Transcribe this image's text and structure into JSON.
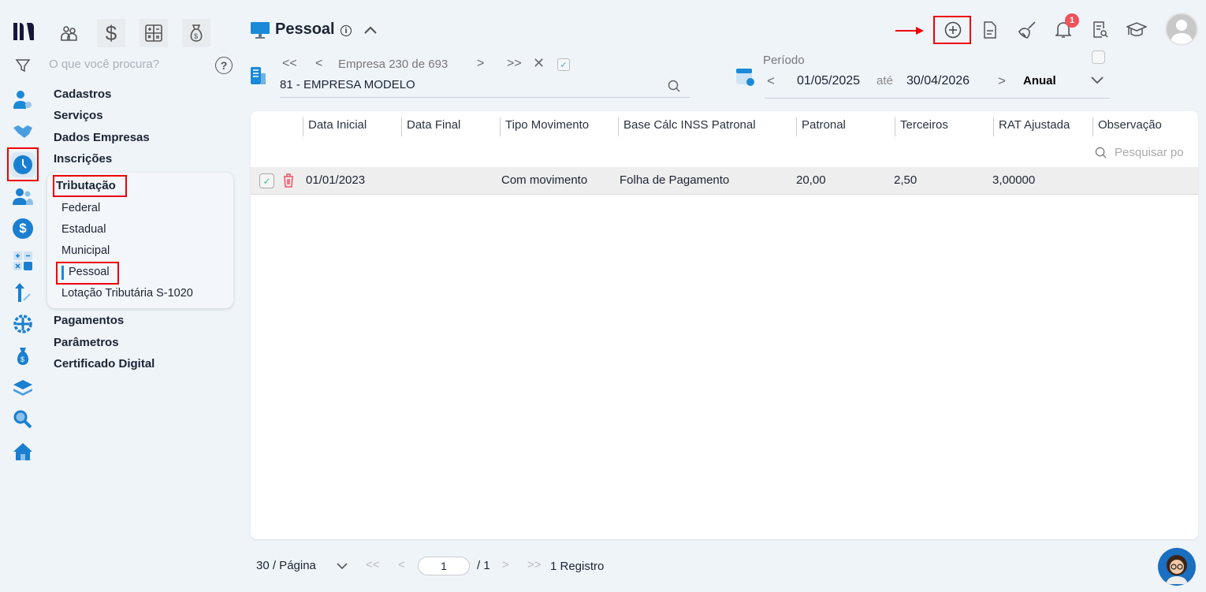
{
  "top_apps": [
    "people-icon",
    "dollar-icon",
    "calculator-icon",
    "money-bag-icon"
  ],
  "search": {
    "placeholder": "O que você procura?"
  },
  "menu": {
    "items": [
      "Cadastros",
      "Serviços",
      "Dados Empresas",
      "Inscrições"
    ],
    "group": {
      "label": "Tributação",
      "children": [
        "Federal",
        "Estadual",
        "Municipal",
        "Pessoal",
        "Lotação Tributária S-1020"
      ],
      "active": "Pessoal"
    },
    "items_after": [
      "Pagamentos",
      "Parâmetros",
      "Certificado Digital"
    ]
  },
  "header": {
    "title": "Pessoal",
    "notifications": "1"
  },
  "company": {
    "nav_text": "Empresa 230 de 693",
    "name": "81 - EMPRESA MODELO"
  },
  "period": {
    "label": "Período",
    "start": "01/05/2025",
    "separator": "até",
    "end": "30/04/2026",
    "type": "Anual"
  },
  "table": {
    "columns": [
      "Data Inicial",
      "Data Final",
      "Tipo Movimento",
      "Base Cálc INSS Patronal",
      "Patronal",
      "Terceiros",
      "RAT Ajustada",
      "Observação"
    ],
    "search_placeholder": "Pesquisar po",
    "rows": [
      [
        "01/01/2023",
        "",
        "Com movimento",
        "Folha de Pagamento",
        "20,00",
        "2,50",
        "3,00000",
        ""
      ]
    ]
  },
  "pagination": {
    "per_page": "30 / Página",
    "page": "1",
    "total_pages": "/ 1",
    "records": "1 Registro"
  },
  "colors": {
    "accent": "#1a8ad8",
    "highlight": "#e00000",
    "brand": "#14163a"
  }
}
